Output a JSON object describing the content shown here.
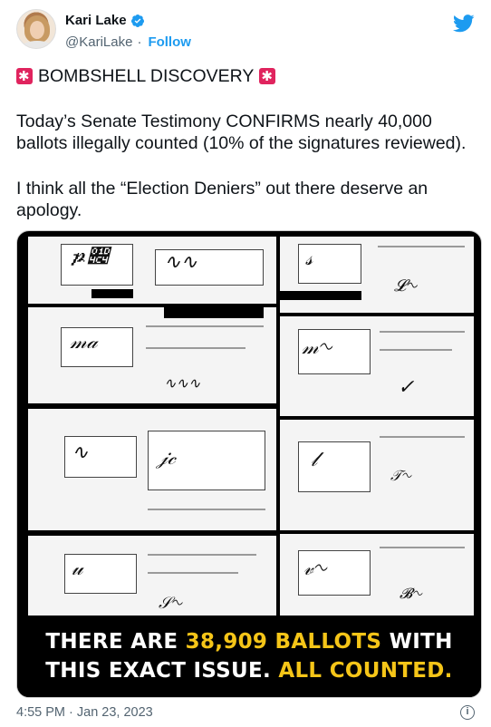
{
  "author": {
    "name": "Kari Lake",
    "handle": "@KariLake",
    "follow_label": "Follow",
    "verified": true
  },
  "icons": {
    "verified": "verified-badge-icon",
    "logo": "twitter-bird-icon",
    "siren": "police-siren-icon",
    "info": "info-icon"
  },
  "colors": {
    "link": "#1d9bf0",
    "highlight": "#f5c518",
    "siren": "#e0245e"
  },
  "tweet": {
    "headline": "BOMBSHELL DISCOVERY",
    "paragraph1": "Today’s Senate Testimony CONFIRMS nearly 40,000 ballots illegally counted (10% of the signatures reviewed).",
    "paragraph2": "I think all the “Election Deniers” out there deserve an apology."
  },
  "media": {
    "overlay_part1": "THERE ARE ",
    "overlay_highlight1": "38,909 BALLOTS",
    "overlay_part2": " WITH",
    "overlay_part3": "THIS EXACT ISSUE. ",
    "overlay_highlight2": "ALL COUNTED."
  },
  "footer": {
    "timestamp": "4:55 PM · Jan 23, 2023",
    "info_glyph": "i"
  }
}
